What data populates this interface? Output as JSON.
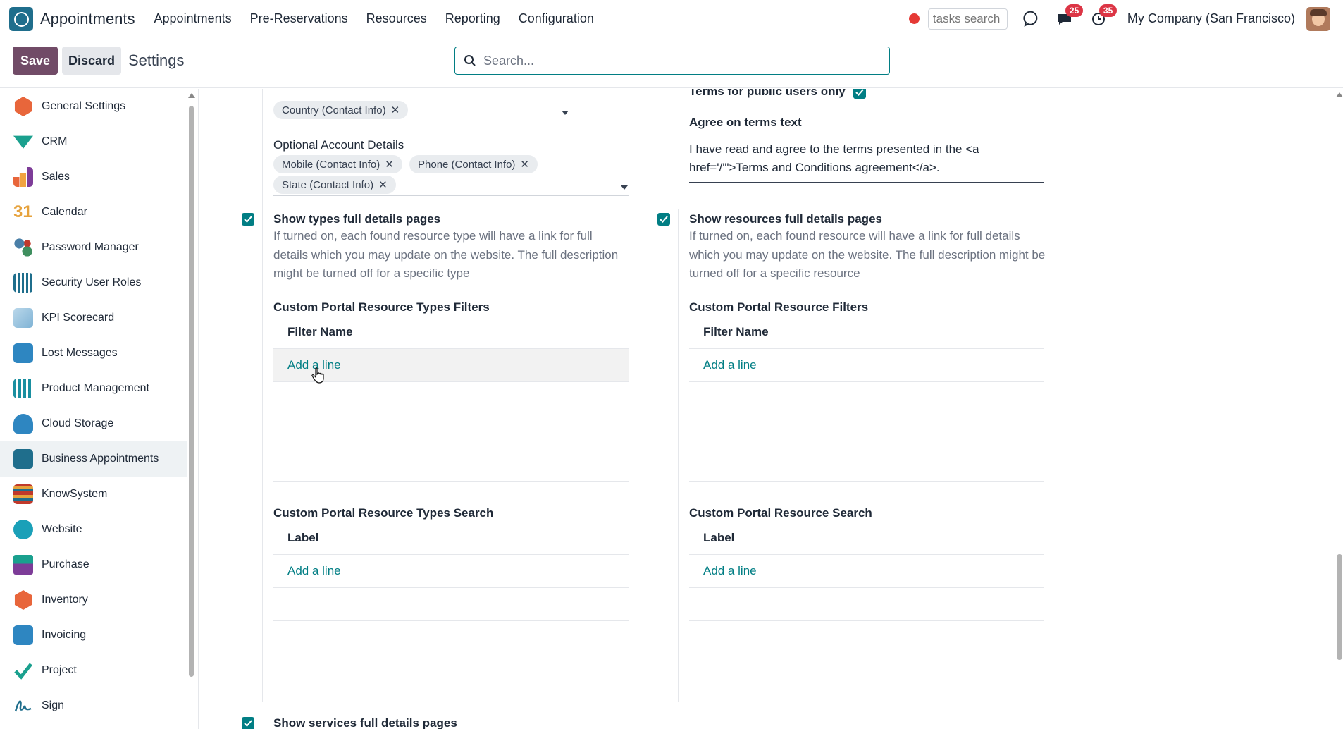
{
  "navbar": {
    "app_name": "Appointments",
    "menu": [
      "Appointments",
      "Pre-Reservations",
      "Resources",
      "Reporting",
      "Configuration"
    ],
    "task_search_placeholder": "tasks search",
    "messages_badge": "25",
    "activities_badge": "35",
    "company": "My Company (San Francisco)"
  },
  "control": {
    "save_label": "Save",
    "discard_label": "Discard",
    "breadcrumb": "Settings",
    "search_placeholder": "Search..."
  },
  "sidebar": {
    "items": [
      {
        "label": "General Settings",
        "icon": "general-settings-icon",
        "color": "#e8663b"
      },
      {
        "label": "CRM",
        "icon": "crm-icon",
        "color": "#1aa08e"
      },
      {
        "label": "Sales",
        "icon": "sales-icon",
        "color": "#e8663b"
      },
      {
        "label": "Calendar",
        "icon": "calendar-icon",
        "color": "#e6a23c"
      },
      {
        "label": "Password Manager",
        "icon": "password-manager-icon",
        "color": "#4a7fa7"
      },
      {
        "label": "Security User Roles",
        "icon": "security-roles-icon",
        "color": "#1f6e8c"
      },
      {
        "label": "KPI Scorecard",
        "icon": "kpi-scorecard-icon",
        "color": "#7fb3d5"
      },
      {
        "label": "Lost Messages",
        "icon": "lost-messages-icon",
        "color": "#2e86c1"
      },
      {
        "label": "Product Management",
        "icon": "product-management-icon",
        "color": "#1a8fa0"
      },
      {
        "label": "Cloud Storage",
        "icon": "cloud-storage-icon",
        "color": "#2e86c1"
      },
      {
        "label": "Business Appointments",
        "icon": "business-appointments-icon",
        "color": "#1f6e8c"
      },
      {
        "label": "KnowSystem",
        "icon": "knowsystem-icon",
        "color": "#c0392b"
      },
      {
        "label": "Website",
        "icon": "website-icon",
        "color": "#1aa0b8"
      },
      {
        "label": "Purchase",
        "icon": "purchase-icon",
        "color": "#7d3c98"
      },
      {
        "label": "Inventory",
        "icon": "inventory-icon",
        "color": "#e8663b"
      },
      {
        "label": "Invoicing",
        "icon": "invoicing-icon",
        "color": "#2e86c1"
      },
      {
        "label": "Project",
        "icon": "project-icon",
        "color": "#1aa08e"
      },
      {
        "label": "Sign",
        "icon": "sign-icon",
        "color": "#1f6e8c"
      }
    ],
    "active": "Business Appointments"
  },
  "settings": {
    "country_tag": "Country (Contact Info)",
    "optional_account_label": "Optional Account Details",
    "optional_tags": [
      "Mobile (Contact Info)",
      "Phone (Contact Info)",
      "State (Contact Info)"
    ],
    "terms_public_label": "Terms for public users only",
    "agree_label": "Agree on terms text",
    "agree_text_line1": "I have read and agree to the terms presented in the <a",
    "agree_text_line2": "href='/'\">Terms and Conditions agreement</a>.",
    "types_full_label": "Show types full details pages",
    "types_full_desc": "If turned on, each found resource type will have a link for full details which you may update on the website. The full description might be turned off for a specific type",
    "resources_full_label": "Show resources full details pages",
    "resources_full_desc": "If turned on, each found resource will have a link for full details which you may update on the website. The full description might be turned off for a specific resource",
    "types_filters_label": "Custom Portal Resource Types Filters",
    "resource_filters_label": "Custom Portal Resource Filters",
    "filter_col": "Filter Name",
    "types_search_label": "Custom Portal Resource Types Search",
    "resource_search_label": "Custom Portal Resource Search",
    "label_col": "Label",
    "add_line": "Add a line",
    "services_full_label": "Show services full details pages"
  },
  "colors": {
    "accent": "#017e84",
    "primary": "#714b67"
  }
}
